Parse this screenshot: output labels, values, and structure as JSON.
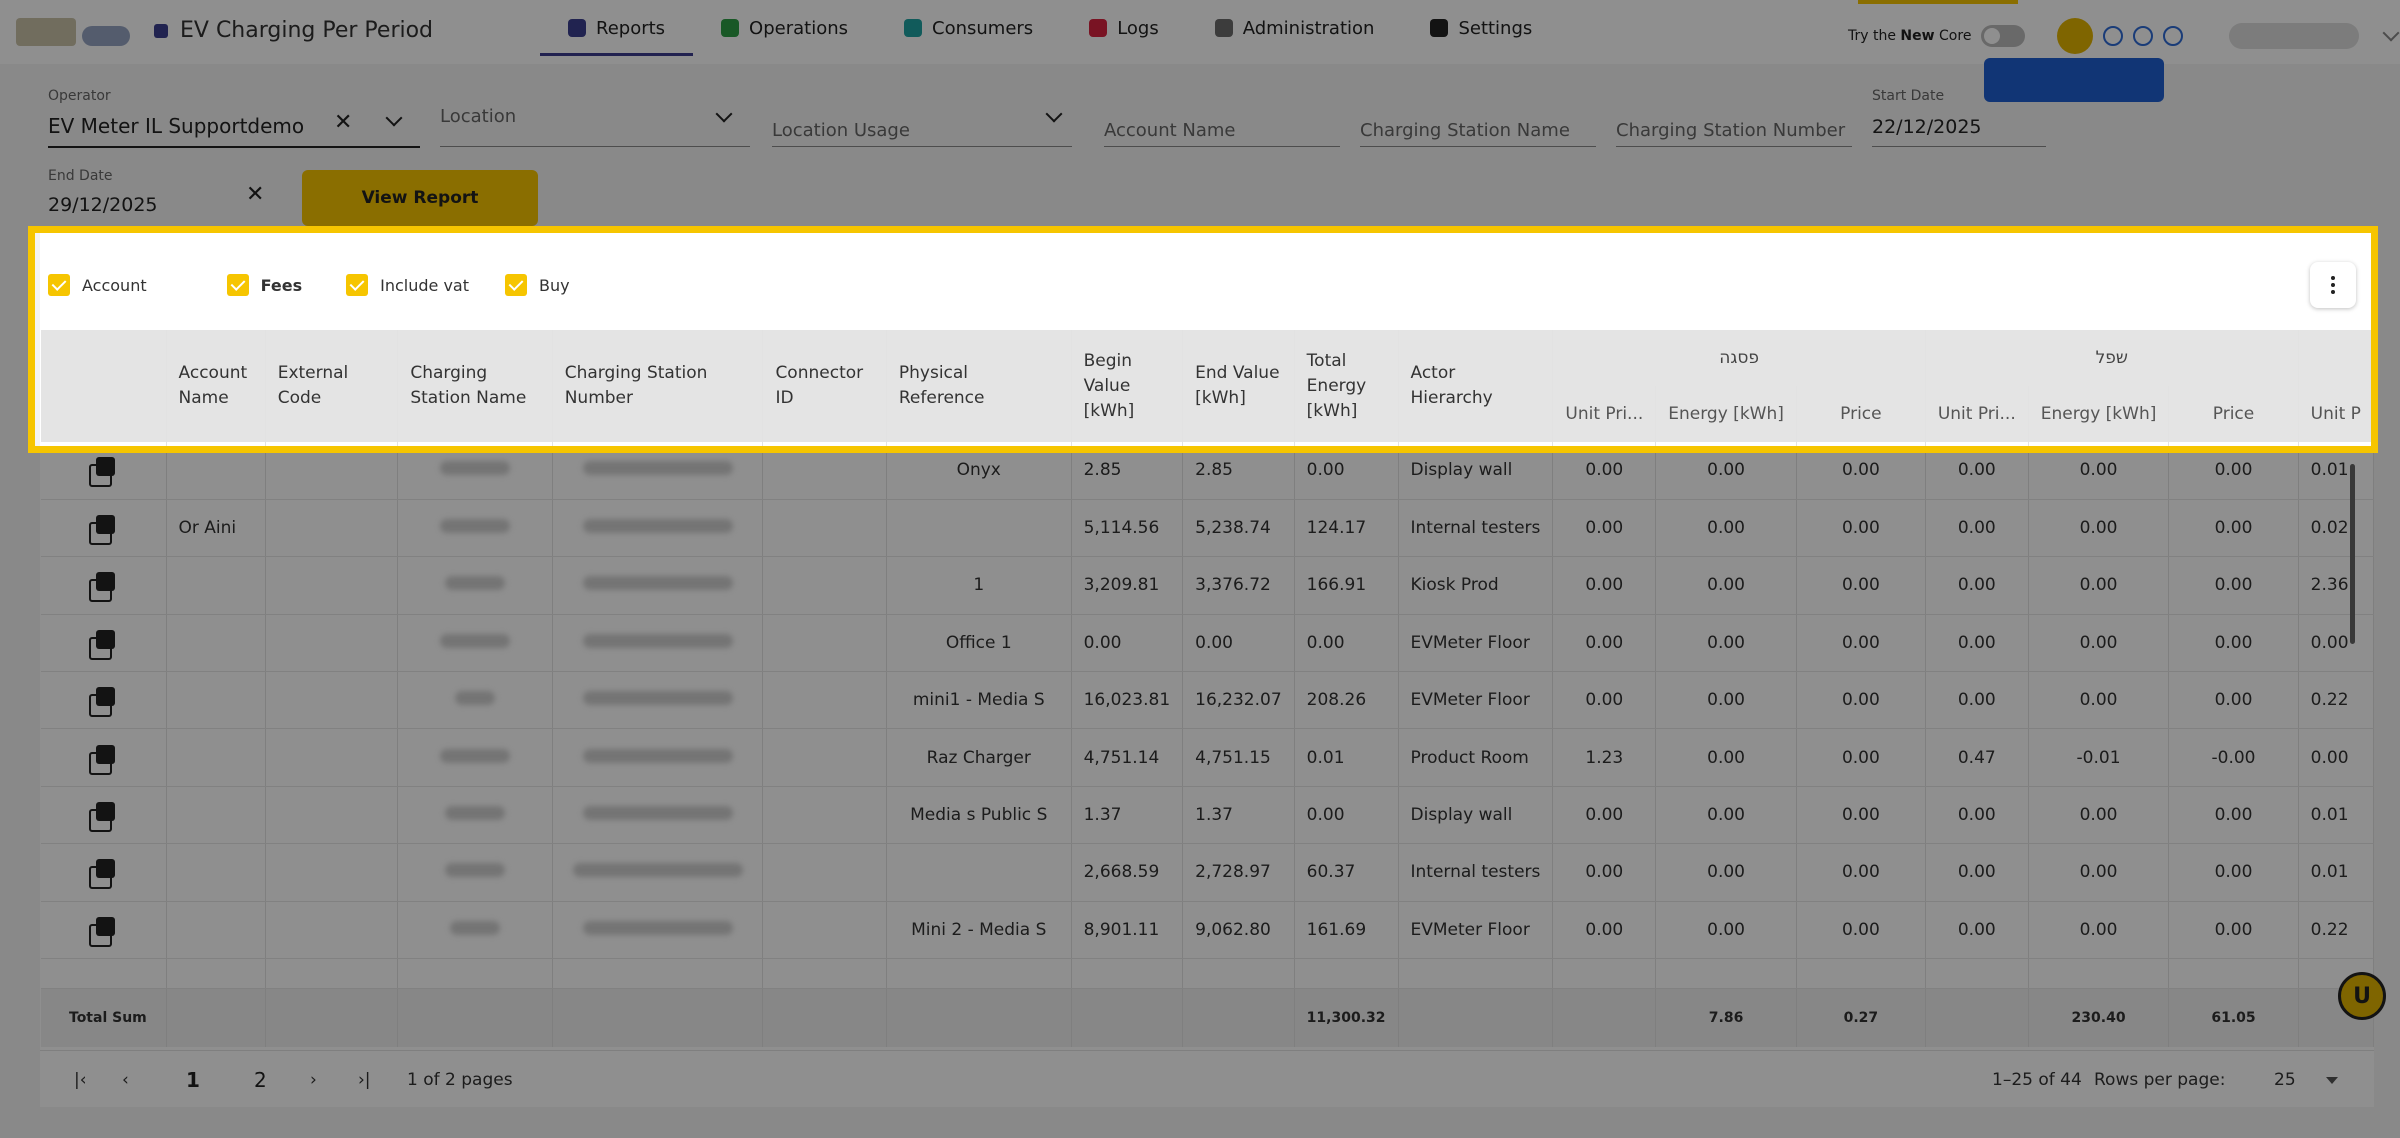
{
  "app": {
    "page_title": "EV Charging Per Period"
  },
  "nav": [
    {
      "label": "Reports",
      "icon": "chart-icon",
      "color": "#3b3f8f"
    },
    {
      "label": "Operations",
      "icon": "clipboard-icon",
      "color": "#2e9e44"
    },
    {
      "label": "Consumers",
      "icon": "people-icon",
      "color": "#1fa3a3"
    },
    {
      "label": "Logs",
      "icon": "alert-icon",
      "color": "#d8223f"
    },
    {
      "label": "Administration",
      "icon": "admin-icon",
      "color": "#6b6b6b"
    },
    {
      "label": "Settings",
      "icon": "gear-icon",
      "color": "#222222"
    }
  ],
  "header_tools": {
    "try_prefix": "Try the ",
    "try_new": "New",
    "try_suffix": " Core"
  },
  "filters": {
    "operator_label": "Operator",
    "operator_value": "EV Meter IL Supportdemo",
    "location_placeholder": "Location",
    "location_usage_placeholder": "Location Usage",
    "account_name_placeholder": "Account Name",
    "charging_station_name_placeholder": "Charging Station Name",
    "charging_station_number_placeholder": "Charging Station Number",
    "start_date_label": "Start Date",
    "start_date_value": "22/12/2025",
    "end_date_label": "End Date",
    "end_date_value": "29/12/2025",
    "view_report_label": "View Report"
  },
  "checkboxes": [
    {
      "label": "Account",
      "checked": true
    },
    {
      "label": "Fees",
      "checked": true
    },
    {
      "label": "Include vat",
      "checked": true
    },
    {
      "label": "Buy",
      "checked": true
    }
  ],
  "table": {
    "columns": {
      "account_name": "Account Name",
      "external_code": "External Code",
      "charging_station_name": "Charging Station Name",
      "charging_station_number": "Charging Station Number",
      "connector_id": "Connector ID",
      "physical_reference": "Physical Reference",
      "begin_value": "Begin Value [kWh]",
      "end_value": "End Value [kWh]",
      "total_energy": "Total Energy [kWh]",
      "actor_hierarchy": "Actor Hierarchy"
    },
    "groups": {
      "peak": "פסגה",
      "offpeak": "שפל"
    },
    "sub_columns": {
      "unit_price": "Unit Pri...",
      "energy": "Energy [kWh]",
      "price": "Price",
      "unit_price_partial": "Unit P"
    },
    "rows": [
      {
        "account": "",
        "physical": "Onyx",
        "physical_align": "c",
        "begin": "2.85",
        "end": "2.85",
        "total": "0.00",
        "actor": "Display wall",
        "p_unit": "0.00",
        "p_energy": "0.00",
        "p_price": "0.00",
        "o_unit": "0.00",
        "o_energy": "0.00",
        "o_price": "0.00",
        "x_unit": "0.01",
        "blur_a": 70,
        "blur_b": 150
      },
      {
        "account": "Or Aini",
        "physical": "",
        "physical_align": "c",
        "begin": "5,114.56",
        "end": "5,238.74",
        "total": "124.17",
        "actor": "Internal testers",
        "p_unit": "0.00",
        "p_energy": "0.00",
        "p_price": "0.00",
        "o_unit": "0.00",
        "o_energy": "0.00",
        "o_price": "0.00",
        "x_unit": "0.02",
        "blur_a": 70,
        "blur_b": 150
      },
      {
        "account": "",
        "physical": "1",
        "physical_align": "c",
        "begin": "3,209.81",
        "end": "3,376.72",
        "total": "166.91",
        "actor": "Kiosk Prod",
        "p_unit": "0.00",
        "p_energy": "0.00",
        "p_price": "0.00",
        "o_unit": "0.00",
        "o_energy": "0.00",
        "o_price": "0.00",
        "x_unit": "2.36",
        "blur_a": 60,
        "blur_b": 150
      },
      {
        "account": "",
        "physical": "Office 1",
        "physical_align": "c",
        "begin": "0.00",
        "end": "0.00",
        "total": "0.00",
        "actor": "EVMeter Floor",
        "p_unit": "0.00",
        "p_energy": "0.00",
        "p_price": "0.00",
        "o_unit": "0.00",
        "o_energy": "0.00",
        "o_price": "0.00",
        "x_unit": "0.00",
        "blur_a": 70,
        "blur_b": 150
      },
      {
        "account": "",
        "physical": "mini1 - Media S",
        "physical_align": "c",
        "begin": "16,023.81",
        "end": "16,232.07",
        "total": "208.26",
        "actor": "EVMeter Floor",
        "p_unit": "0.00",
        "p_energy": "0.00",
        "p_price": "0.00",
        "o_unit": "0.00",
        "o_energy": "0.00",
        "o_price": "0.00",
        "x_unit": "0.22",
        "blur_a": 40,
        "blur_b": 150
      },
      {
        "account": "",
        "physical": "Raz Charger",
        "physical_align": "c",
        "begin": "4,751.14",
        "end": "4,751.15",
        "total": "0.01",
        "actor": "Product Room",
        "p_unit": "1.23",
        "p_energy": "0.00",
        "p_price": "0.00",
        "o_unit": "0.47",
        "o_energy": "-0.01",
        "o_price": "-0.00",
        "x_unit": "0.00",
        "blur_a": 70,
        "blur_b": 150
      },
      {
        "account": "",
        "physical": "Media s Public S",
        "physical_align": "c",
        "begin": "1.37",
        "end": "1.37",
        "total": "0.00",
        "actor": "Display wall",
        "p_unit": "0.00",
        "p_energy": "0.00",
        "p_price": "0.00",
        "o_unit": "0.00",
        "o_energy": "0.00",
        "o_price": "0.00",
        "x_unit": "0.01",
        "blur_a": 60,
        "blur_b": 150
      },
      {
        "account": "",
        "physical": "",
        "physical_align": "c",
        "begin": "2,668.59",
        "end": "2,728.97",
        "total": "60.37",
        "actor": "Internal testers",
        "p_unit": "0.00",
        "p_energy": "0.00",
        "p_price": "0.00",
        "o_unit": "0.00",
        "o_energy": "0.00",
        "o_price": "0.00",
        "x_unit": "0.01",
        "blur_a": 60,
        "blur_b": 170
      },
      {
        "account": "",
        "physical": "Mini 2 - Media S",
        "physical_align": "c",
        "begin": "8,901.11",
        "end": "9,062.80",
        "total": "161.69",
        "actor": "EVMeter Floor",
        "p_unit": "0.00",
        "p_energy": "0.00",
        "p_price": "0.00",
        "o_unit": "0.00",
        "o_energy": "0.00",
        "o_price": "0.00",
        "x_unit": "0.22",
        "blur_a": 50,
        "blur_b": 150
      }
    ],
    "total": {
      "label": "Total Sum",
      "total_energy": "11,300.32",
      "p_energy": "7.86",
      "p_price": "0.27",
      "o_energy": "230.40",
      "o_price": "61.05"
    }
  },
  "pagination": {
    "page_1": "1",
    "page_2": "2",
    "page_info": "1 of 2 pages",
    "range": "1–25 of 44",
    "rows_per_page_label": "Rows per page:",
    "rows_per_page_value": "25"
  },
  "fab_label": "U"
}
